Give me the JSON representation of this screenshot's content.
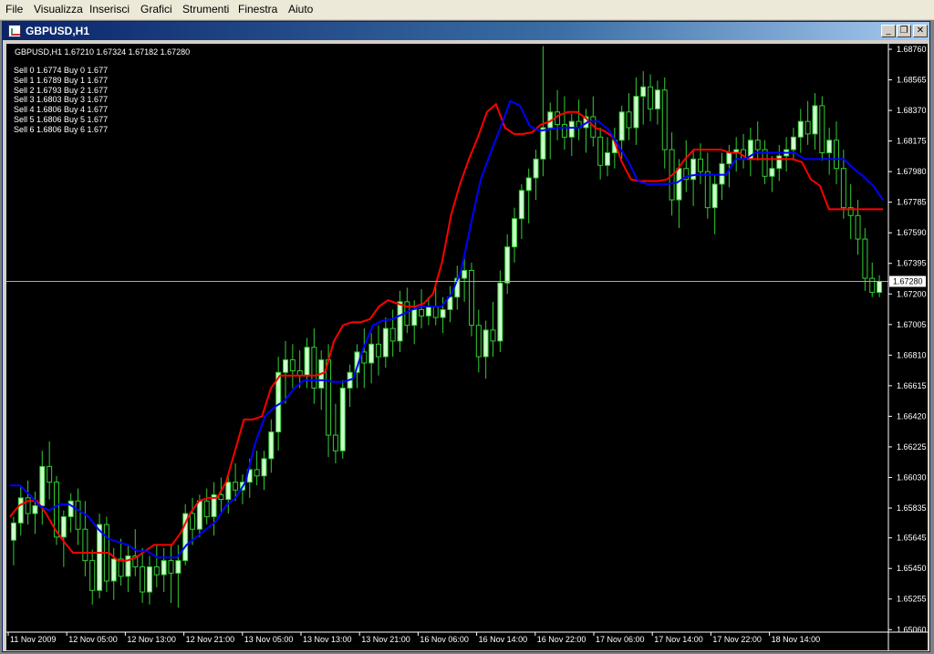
{
  "menu": [
    "File",
    "Visualizza",
    "Inserisci",
    "Grafici",
    "Strumenti",
    "Finestra",
    "Aiuto"
  ],
  "window": {
    "title": "GBPUSD,H1",
    "buttons": {
      "minimize": "_",
      "restore": "❐",
      "close": "✕"
    }
  },
  "header": {
    "ohlc": "GBPUSD,H1  1.67210 1.67324 1.67182 1.67280"
  },
  "levels": [
    "Sell 0 1.6774 Buy 0 1.677",
    "Sell 1 1.6789 Buy 1 1.677",
    "Sell 2 1.6793 Buy 2 1.677",
    "Sell 3 1.6803 Buy 3 1.677",
    "Sell 4 1.6806 Buy 4 1.677",
    "Sell 5 1.6806 Buy 5 1.677",
    "Sell 6 1.6806 Buy 6 1.677"
  ],
  "colors": {
    "background": "#000000",
    "bull_candle": "#ccffcc",
    "bear_candle": "#000000",
    "wick": "#33cc33",
    "line_red": "#ff0000",
    "line_blue": "#0000ff",
    "axis_text": "#ffffff",
    "current_price_line": "#aaaaaa"
  },
  "chart_data": {
    "type": "candlestick",
    "symbol": "GBPUSD",
    "timeframe": "H1",
    "ylim": [
      1.6505,
      1.6876
    ],
    "y_ticks": [
      "1.68760",
      "1.68565",
      "1.68370",
      "1.68175",
      "1.67980",
      "1.67785",
      "1.67590",
      "1.67395",
      "1.67200",
      "1.67005",
      "1.66810",
      "1.66615",
      "1.66420",
      "1.66225",
      "1.66030",
      "1.65835",
      "1.65645",
      "1.65450",
      "1.65255",
      "1.65060"
    ],
    "x_ticks": [
      "11 Nov 2009",
      "12 Nov 05:00",
      "12 Nov 13:00",
      "12 Nov 21:00",
      "13 Nov 05:00",
      "13 Nov 13:00",
      "13 Nov 21:00",
      "16 Nov 06:00",
      "16 Nov 14:00",
      "16 Nov 22:00",
      "17 Nov 06:00",
      "17 Nov 14:00",
      "17 Nov 22:00",
      "18 Nov 14:00"
    ],
    "current_price": "1.67280",
    "candles": [
      [
        1.6563,
        1.6578,
        1.6547,
        1.6574
      ],
      [
        1.6574,
        1.6598,
        1.6566,
        1.659
      ],
      [
        1.659,
        1.6601,
        1.6573,
        1.658
      ],
      [
        1.658,
        1.6594,
        1.6567,
        1.6585
      ],
      [
        1.6585,
        1.662,
        1.6573,
        1.661
      ],
      [
        1.661,
        1.6626,
        1.6589,
        1.66
      ],
      [
        1.66,
        1.6604,
        1.656,
        1.6565
      ],
      [
        1.6565,
        1.6582,
        1.6546,
        1.6578
      ],
      [
        1.6578,
        1.6593,
        1.6568,
        1.6588
      ],
      [
        1.6588,
        1.6596,
        1.656,
        1.657
      ],
      [
        1.657,
        1.6588,
        1.654,
        1.655
      ],
      [
        1.655,
        1.6557,
        1.6522,
        1.6531
      ],
      [
        1.6531,
        1.658,
        1.6526,
        1.6573
      ],
      [
        1.6573,
        1.6578,
        1.653,
        1.6537
      ],
      [
        1.6537,
        1.6558,
        1.6525,
        1.6551
      ],
      [
        1.6551,
        1.6564,
        1.6534,
        1.654
      ],
      [
        1.654,
        1.656,
        1.653,
        1.6553
      ],
      [
        1.6553,
        1.657,
        1.654,
        1.6546
      ],
      [
        1.6546,
        1.6558,
        1.6523,
        1.653
      ],
      [
        1.653,
        1.6553,
        1.6522,
        1.6546
      ],
      [
        1.6546,
        1.656,
        1.6533,
        1.6541
      ],
      [
        1.6541,
        1.6558,
        1.653,
        1.655
      ],
      [
        1.655,
        1.656,
        1.6523,
        1.6542
      ],
      [
        1.6542,
        1.656,
        1.652,
        1.655
      ],
      [
        1.655,
        1.6586,
        1.6547,
        1.658
      ],
      [
        1.658,
        1.659,
        1.656,
        1.657
      ],
      [
        1.657,
        1.6592,
        1.6565,
        1.6588
      ],
      [
        1.6588,
        1.6596,
        1.6573,
        1.6578
      ],
      [
        1.6578,
        1.66,
        1.6566,
        1.6592
      ],
      [
        1.6592,
        1.6603,
        1.658,
        1.6589
      ],
      [
        1.6589,
        1.6605,
        1.658,
        1.66
      ],
      [
        1.66,
        1.6612,
        1.6588,
        1.6595
      ],
      [
        1.6595,
        1.6605,
        1.6586,
        1.66
      ],
      [
        1.66,
        1.6615,
        1.659,
        1.6608
      ],
      [
        1.6608,
        1.662,
        1.6598,
        1.6604
      ],
      [
        1.6604,
        1.662,
        1.6595,
        1.6615
      ],
      [
        1.6615,
        1.664,
        1.6606,
        1.6632
      ],
      [
        1.6632,
        1.668,
        1.662,
        1.667
      ],
      [
        1.667,
        1.669,
        1.665,
        1.6678
      ],
      [
        1.6678,
        1.6688,
        1.666,
        1.6671
      ],
      [
        1.6671,
        1.6684,
        1.666,
        1.6668
      ],
      [
        1.6668,
        1.6692,
        1.666,
        1.6686
      ],
      [
        1.6686,
        1.6698,
        1.665,
        1.666
      ],
      [
        1.666,
        1.6684,
        1.6646,
        1.6678
      ],
      [
        1.6678,
        1.6688,
        1.6616,
        1.663
      ],
      [
        1.663,
        1.665,
        1.6612,
        1.662
      ],
      [
        1.662,
        1.6665,
        1.6615,
        1.666
      ],
      [
        1.666,
        1.6675,
        1.6648,
        1.667
      ],
      [
        1.667,
        1.6688,
        1.666,
        1.6683
      ],
      [
        1.6683,
        1.6698,
        1.666,
        1.6676
      ],
      [
        1.6676,
        1.6695,
        1.6663,
        1.6688
      ],
      [
        1.6688,
        1.67,
        1.6668,
        1.668
      ],
      [
        1.668,
        1.6705,
        1.6673,
        1.6698
      ],
      [
        1.6698,
        1.671,
        1.668,
        1.669
      ],
      [
        1.669,
        1.6722,
        1.6683,
        1.6715
      ],
      [
        1.6715,
        1.6724,
        1.6695,
        1.67
      ],
      [
        1.67,
        1.6716,
        1.6688,
        1.671
      ],
      [
        1.671,
        1.6723,
        1.6698,
        1.6706
      ],
      [
        1.6706,
        1.6718,
        1.67,
        1.6712
      ],
      [
        1.6712,
        1.6726,
        1.67,
        1.6705
      ],
      [
        1.6705,
        1.6718,
        1.6695,
        1.671
      ],
      [
        1.671,
        1.6725,
        1.6702,
        1.6718
      ],
      [
        1.6718,
        1.6738,
        1.671,
        1.673
      ],
      [
        1.673,
        1.6743,
        1.6715,
        1.6735
      ],
      [
        1.6735,
        1.674,
        1.6693,
        1.67
      ],
      [
        1.67,
        1.671,
        1.667,
        1.668
      ],
      [
        1.668,
        1.6703,
        1.6666,
        1.6697
      ],
      [
        1.6697,
        1.6715,
        1.668,
        1.669
      ],
      [
        1.669,
        1.6735,
        1.6683,
        1.6727
      ],
      [
        1.6727,
        1.6758,
        1.672,
        1.675
      ],
      [
        1.675,
        1.6775,
        1.674,
        1.6768
      ],
      [
        1.6768,
        1.679,
        1.6755,
        1.6786
      ],
      [
        1.6786,
        1.68,
        1.6765,
        1.6794
      ],
      [
        1.6794,
        1.6812,
        1.678,
        1.6806
      ],
      [
        1.6806,
        1.6878,
        1.6795,
        1.6826
      ],
      [
        1.6826,
        1.6842,
        1.6806,
        1.6836
      ],
      [
        1.6836,
        1.685,
        1.6818,
        1.6828
      ],
      [
        1.6828,
        1.6846,
        1.6812,
        1.682
      ],
      [
        1.682,
        1.6835,
        1.6808,
        1.683
      ],
      [
        1.683,
        1.6844,
        1.6818,
        1.6826
      ],
      [
        1.6826,
        1.6838,
        1.681,
        1.6833
      ],
      [
        1.6833,
        1.6846,
        1.6814,
        1.682
      ],
      [
        1.682,
        1.6826,
        1.6793,
        1.6802
      ],
      [
        1.6802,
        1.682,
        1.6795,
        1.681
      ],
      [
        1.681,
        1.6826,
        1.68,
        1.6818
      ],
      [
        1.6818,
        1.684,
        1.6806,
        1.6836
      ],
      [
        1.6836,
        1.6848,
        1.6818,
        1.6826
      ],
      [
        1.6826,
        1.6858,
        1.6815,
        1.6846
      ],
      [
        1.6846,
        1.6862,
        1.6828,
        1.6852
      ],
      [
        1.6852,
        1.686,
        1.683,
        1.6838
      ],
      [
        1.6838,
        1.6856,
        1.6828,
        1.685
      ],
      [
        1.685,
        1.6858,
        1.68,
        1.6812
      ],
      [
        1.6812,
        1.6823,
        1.677,
        1.678
      ],
      [
        1.678,
        1.6806,
        1.6762,
        1.68
      ],
      [
        1.68,
        1.6818,
        1.6785,
        1.6793
      ],
      [
        1.6793,
        1.6812,
        1.6776,
        1.6806
      ],
      [
        1.6806,
        1.6816,
        1.679,
        1.6798
      ],
      [
        1.6798,
        1.681,
        1.6768,
        1.6775
      ],
      [
        1.6775,
        1.6796,
        1.6758,
        1.679
      ],
      [
        1.679,
        1.681,
        1.678,
        1.6803
      ],
      [
        1.6803,
        1.6815,
        1.6788,
        1.681
      ],
      [
        1.681,
        1.682,
        1.6798,
        1.6812
      ],
      [
        1.6812,
        1.6822,
        1.68,
        1.6806
      ],
      [
        1.6806,
        1.6826,
        1.6795,
        1.6818
      ],
      [
        1.6818,
        1.683,
        1.6805,
        1.6812
      ],
      [
        1.6812,
        1.6818,
        1.679,
        1.6795
      ],
      [
        1.6795,
        1.6808,
        1.6785,
        1.68
      ],
      [
        1.68,
        1.6815,
        1.6792,
        1.6808
      ],
      [
        1.6808,
        1.682,
        1.6798,
        1.6812
      ],
      [
        1.6812,
        1.6826,
        1.6805,
        1.682
      ],
      [
        1.682,
        1.6838,
        1.681,
        1.683
      ],
      [
        1.683,
        1.6843,
        1.6815,
        1.6822
      ],
      [
        1.6822,
        1.6848,
        1.6812,
        1.684
      ],
      [
        1.684,
        1.6846,
        1.6805,
        1.681
      ],
      [
        1.681,
        1.6826,
        1.6796,
        1.6818
      ],
      [
        1.6818,
        1.683,
        1.679,
        1.68
      ],
      [
        1.68,
        1.6812,
        1.6768,
        1.6775
      ],
      [
        1.6775,
        1.679,
        1.6755,
        1.677
      ],
      [
        1.677,
        1.678,
        1.6745,
        1.6755
      ],
      [
        1.6755,
        1.6762,
        1.6722,
        1.673
      ],
      [
        1.673,
        1.674,
        1.6718,
        1.6721
      ],
      [
        1.6721,
        1.6732,
        1.6718,
        1.6728
      ]
    ],
    "series": [
      {
        "color": "#ff0000",
        "values": [
          1.6578,
          1.6585,
          1.6588,
          1.6588,
          1.658,
          1.657,
          1.6562,
          1.6555,
          1.6555,
          1.6555,
          1.6555,
          1.6555,
          1.655,
          1.655,
          1.6552,
          1.6556,
          1.656,
          1.656,
          1.656,
          1.6568,
          1.658,
          1.6588,
          1.659,
          1.659,
          1.66,
          1.662,
          1.664,
          1.664,
          1.6642,
          1.666,
          1.6668,
          1.6668,
          1.6668,
          1.6668,
          1.6668,
          1.667,
          1.669,
          1.67,
          1.6702,
          1.6702,
          1.6704,
          1.6712,
          1.6716,
          1.6714,
          1.6712,
          1.6712,
          1.6714,
          1.672,
          1.674,
          1.677,
          1.679,
          1.6806,
          1.682,
          1.6836,
          1.6841,
          1.6826,
          1.6822,
          1.6822,
          1.6823,
          1.6828,
          1.683,
          1.6834,
          1.6836,
          1.6836,
          1.6832,
          1.6826,
          1.6824,
          1.682,
          1.6804,
          1.6793,
          1.6792,
          1.6792,
          1.6792,
          1.6793,
          1.6798,
          1.6806,
          1.6812,
          1.6812,
          1.6812,
          1.6812,
          1.681,
          1.681,
          1.6806,
          1.6806,
          1.6806,
          1.6806,
          1.6806,
          1.6806,
          1.6804,
          1.6793,
          1.6789,
          1.6774,
          1.6774,
          1.6774,
          1.6774,
          1.6774,
          1.6774,
          1.6774
        ]
      },
      {
        "color": "#0000ff",
        "values": [
          1.6598,
          1.6598,
          1.6592,
          1.6585,
          1.6582,
          1.6586,
          1.6586,
          1.6582,
          1.6578,
          1.657,
          1.6564,
          1.6562,
          1.656,
          1.6556,
          1.6556,
          1.6552,
          1.6552,
          1.6552,
          1.656,
          1.6565,
          1.657,
          1.6575,
          1.6585,
          1.659,
          1.66,
          1.6625,
          1.6642,
          1.6648,
          1.6652,
          1.666,
          1.6665,
          1.6665,
          1.6665,
          1.6664,
          1.6664,
          1.6666,
          1.6685,
          1.67,
          1.6703,
          1.6704,
          1.6707,
          1.671,
          1.6712,
          1.6712,
          1.6712,
          1.672,
          1.6735,
          1.6765,
          1.6793,
          1.681,
          1.6826,
          1.6843,
          1.684,
          1.6827,
          1.6824,
          1.6825,
          1.6826,
          1.6826,
          1.6826,
          1.683,
          1.683,
          1.6825,
          1.6815,
          1.6805,
          1.6792,
          1.679,
          1.679,
          1.679,
          1.6791,
          1.6795,
          1.6796,
          1.6796,
          1.6796,
          1.6796,
          1.6806,
          1.6806,
          1.681,
          1.681,
          1.681,
          1.681,
          1.681,
          1.6806,
          1.6806,
          1.6806,
          1.6806,
          1.6806,
          1.68,
          1.6795,
          1.6789,
          1.678
        ]
      }
    ]
  }
}
